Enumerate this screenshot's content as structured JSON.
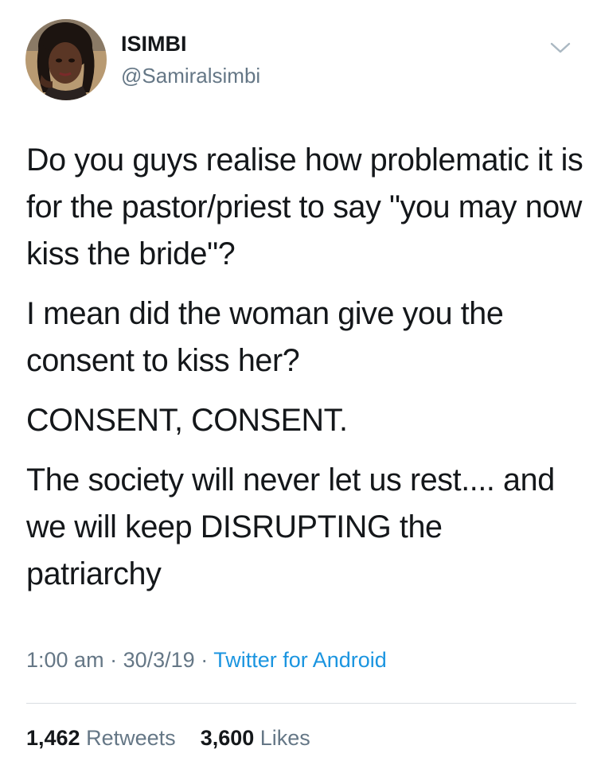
{
  "user": {
    "display_name": "ISIMBI",
    "handle": "@Samiralsimbi",
    "avatar_icon": "profile-photo"
  },
  "menu_icon": "chevron-down-icon",
  "tweet": {
    "paragraphs": [
      "Do you guys realise how problematic it is for the pastor/priest to say \"you may now kiss the bride\"?",
      "I mean did the woman give you the consent to kiss her?",
      "CONSENT, CONSENT.",
      "The society will never let us rest.... and we will keep DISRUPTING the patriarchy"
    ]
  },
  "meta": {
    "time": "1:00 am",
    "separator": "·",
    "date": "30/3/19",
    "source": "Twitter for Android"
  },
  "stats": {
    "retweets_count": "1,462",
    "retweets_label": "Retweets",
    "likes_count": "3,600",
    "likes_label": "Likes"
  },
  "colors": {
    "text": "#14171a",
    "secondary": "#657786",
    "link": "#1b95e0",
    "divider": "#d9dde2"
  }
}
